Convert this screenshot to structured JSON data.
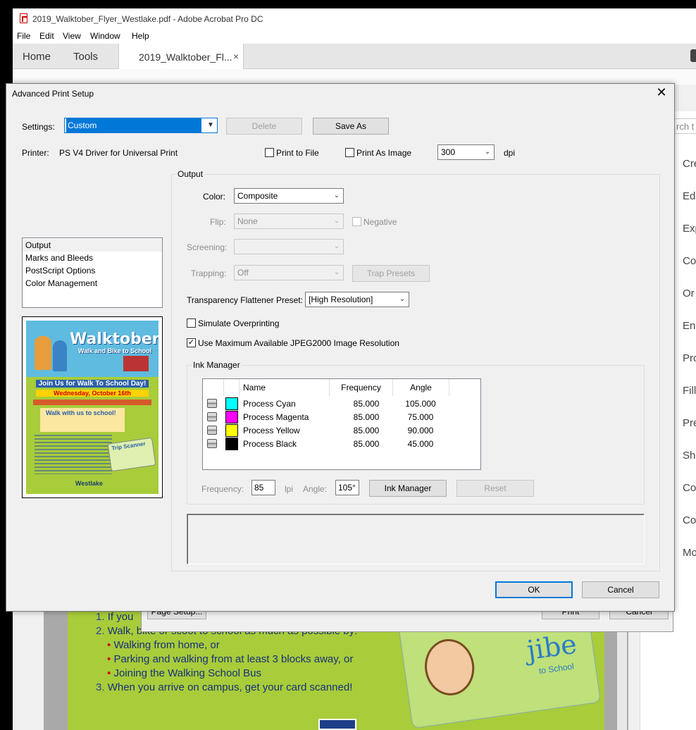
{
  "app": {
    "window_title": "2019_Walktober_Flyer_Westlake.pdf - Adobe Acrobat Pro DC",
    "menu": [
      "File",
      "Edit",
      "View",
      "Window",
      "Help"
    ],
    "tabs": {
      "home": "Home",
      "tools": "Tools",
      "document": "2019_Walktober_Fl...",
      "close": "×"
    },
    "search_placeholder": "rch t",
    "right_pane_items": [
      "Cre",
      "Edi",
      "Exp",
      "Co",
      "Or",
      "Enl",
      "Pro",
      "Fill",
      "Pre",
      "Sh",
      "Co",
      "Co",
      "Mo"
    ]
  },
  "document": {
    "lines": [
      {
        "num": "1.",
        "text": "If you"
      },
      {
        "num": "2.",
        "text": "Walk, bike or scoot to school as much as possible by:"
      },
      {
        "bullet": "•",
        "text": "Walking from home, or"
      },
      {
        "bullet": "•",
        "text": "Parking and walking from at least 3 blocks away, or"
      },
      {
        "bullet": "•",
        "text": "Joining the Walking School Bus"
      },
      {
        "num": "3.",
        "text": "When you arrive on campus, get your card scanned!"
      }
    ],
    "card_logo": "jibe",
    "card_sub": "to School"
  },
  "print_dialog": {
    "page_setup": "Page Setup...",
    "print": "Print",
    "cancel": "Cancel"
  },
  "dialog": {
    "title": "Advanced Print Setup",
    "close": "✕",
    "settings_label": "Settings:",
    "settings_value": "Custom",
    "delete": "Delete",
    "save_as": "Save As",
    "printer_label": "Printer:",
    "printer_value": "PS V4 Driver for Universal Print",
    "print_to_file": "Print to File",
    "print_as_image": "Print As Image",
    "dpi_value": "300",
    "dpi_label": "dpi",
    "categories": [
      "Output",
      "Marks and Bleeds",
      "PostScript Options",
      "Color Management"
    ],
    "preview": {
      "title": "Walktober",
      "subtitle": "Walk and Bike to School",
      "banner1": "Join Us for Walk To School Day!",
      "banner2": "Wednesday, October 16th",
      "box": "Walk with us to school!",
      "card": "Trip Scanner",
      "footer": "Westlake"
    },
    "output": {
      "group_label": "Output",
      "color_label": "Color:",
      "color_value": "Composite",
      "flip_label": "Flip:",
      "flip_value": "None",
      "negative_label": "Negative",
      "screening_label": "Screening:",
      "screening_value": "",
      "trapping_label": "Trapping:",
      "trapping_value": "Off",
      "trap_presets": "Trap Presets",
      "flattener_label": "Transparency Flattener Preset:",
      "flattener_value": "[High Resolution]",
      "simulate_overprinting": "Simulate Overprinting",
      "use_max_jpeg": "Use Maximum Available JPEG2000 Image Resolution",
      "use_max_jpeg_checked": true
    },
    "ink_manager": {
      "group_label": "Ink Manager",
      "headers": {
        "name": "Name",
        "frequency": "Frequency",
        "angle": "Angle"
      },
      "inks": [
        {
          "name": "Process Cyan",
          "frequency": "85.000",
          "angle": "105.000",
          "color": "#00ffff"
        },
        {
          "name": "Process Magenta",
          "frequency": "85.000",
          "angle": "75.000",
          "color": "#ff00ff"
        },
        {
          "name": "Process Yellow",
          "frequency": "85.000",
          "angle": "90.000",
          "color": "#ffff00"
        },
        {
          "name": "Process Black",
          "frequency": "85.000",
          "angle": "45.000",
          "color": "#000000"
        }
      ],
      "frequency_label": "Frequency:",
      "frequency_value": "85",
      "lpi_label": "lpi",
      "angle_label": "Angle:",
      "angle_value": "105°",
      "ink_manager_button": "Ink Manager",
      "reset_button": "Reset"
    },
    "ok": "OK",
    "cancel": "Cancel"
  }
}
